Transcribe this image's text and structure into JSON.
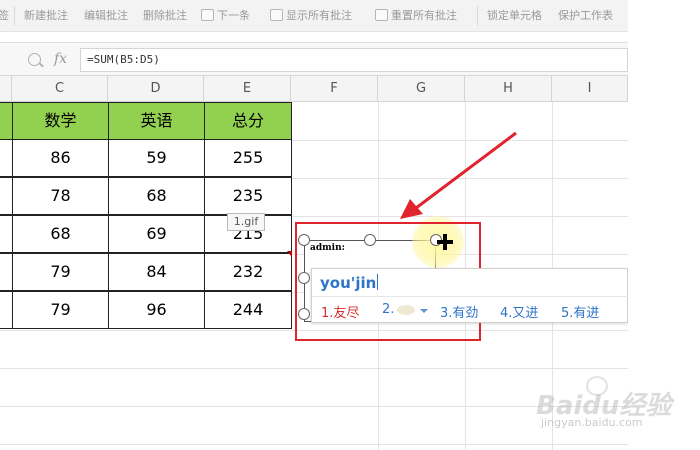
{
  "toolbar": {
    "partial_left": "签",
    "items": [
      "新建批注",
      "编辑批注",
      "删除批注",
      "下一条",
      "显示所有批注",
      "重置所有批注",
      "锁定单元格",
      "保护工作表"
    ]
  },
  "formula_bar": {
    "fx_label": "fx",
    "formula": "=SUM(B5:D5)"
  },
  "columns": [
    "C",
    "D",
    "E",
    "F",
    "G",
    "H",
    "I"
  ],
  "table": {
    "headers": [
      "数学",
      "英语",
      "总分"
    ],
    "rows": [
      [
        "86",
        "59",
        "255"
      ],
      [
        "78",
        "68",
        "235"
      ],
      [
        "68",
        "69",
        "215"
      ],
      [
        "79",
        "84",
        "232"
      ],
      [
        "79",
        "96",
        "244"
      ]
    ]
  },
  "tooltip": "1.gif",
  "comment": {
    "author": "admin:"
  },
  "ime": {
    "typed": "you'jin",
    "candidates": [
      "1.友尽",
      "2.",
      "3.有劲",
      "4.又进",
      "5.有进"
    ]
  },
  "watermark": {
    "logo": "Baidu经验",
    "url": "jingyan.baidu.com"
  },
  "colors": {
    "header_green": "#92d050",
    "annotation_red": "#e0242b",
    "ime_blue": "#2e74c9"
  }
}
